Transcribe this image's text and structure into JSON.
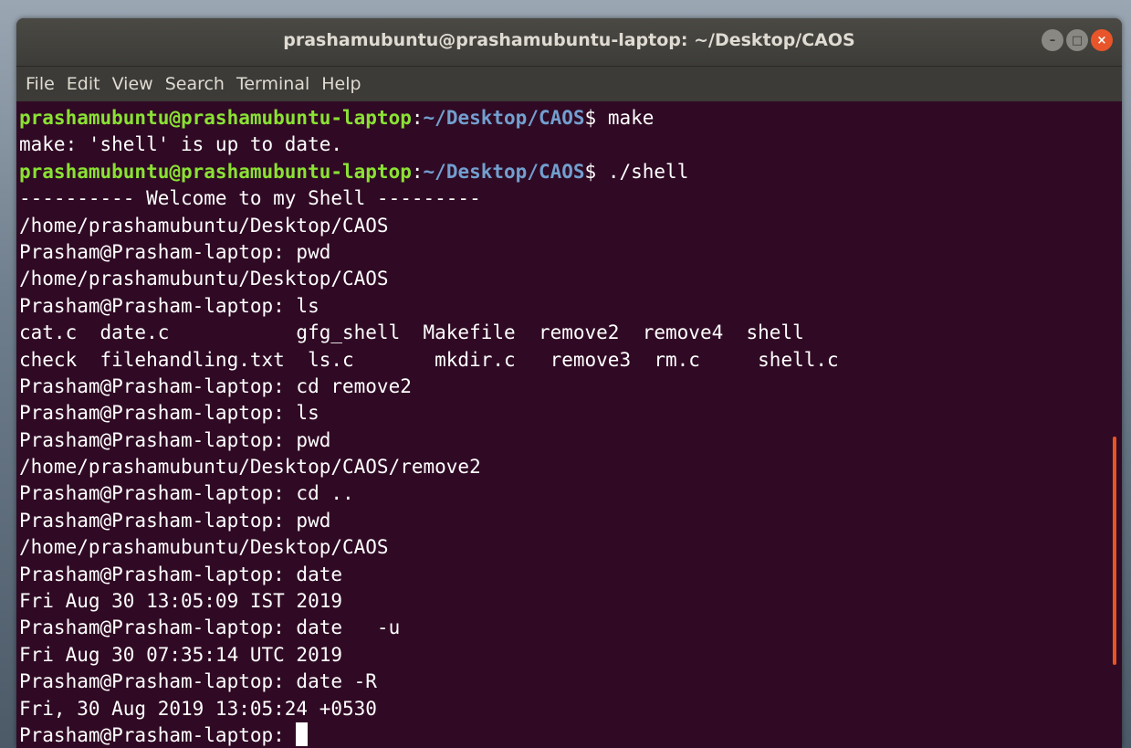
{
  "window": {
    "title": "prashamubuntu@prashamubuntu-laptop: ~/Desktop/CAOS",
    "controls": {
      "minimize": "–",
      "maximize": "□",
      "close": "×"
    }
  },
  "menu": {
    "items": [
      "File",
      "Edit",
      "View",
      "Search",
      "Terminal",
      "Help"
    ]
  },
  "prompt": {
    "user_host": "prashamubuntu@prashamubuntu-laptop",
    "colon": ":",
    "path": "~/Desktop/CAOS",
    "dollar": "$ "
  },
  "terminal": {
    "lines": [
      {
        "kind": "prompt",
        "cmd": "make"
      },
      {
        "kind": "text",
        "text": "make: 'shell' is up to date."
      },
      {
        "kind": "prompt",
        "cmd": "./shell"
      },
      {
        "kind": "text",
        "text": "---------- Welcome to my Shell ---------"
      },
      {
        "kind": "text",
        "text": "/home/prashamubuntu/Desktop/CAOS"
      },
      {
        "kind": "text",
        "text": "Prasham@Prasham-laptop: pwd"
      },
      {
        "kind": "text",
        "text": "/home/prashamubuntu/Desktop/CAOS"
      },
      {
        "kind": "text",
        "text": "Prasham@Prasham-laptop: ls"
      },
      {
        "kind": "text",
        "text": "cat.c  date.c           gfg_shell  Makefile  remove2  remove4  shell"
      },
      {
        "kind": "text",
        "text": "check  filehandling.txt  ls.c       mkdir.c   remove3  rm.c     shell.c"
      },
      {
        "kind": "text",
        "text": "Prasham@Prasham-laptop: cd remove2"
      },
      {
        "kind": "text",
        "text": "Prasham@Prasham-laptop: ls"
      },
      {
        "kind": "text",
        "text": "Prasham@Prasham-laptop: pwd"
      },
      {
        "kind": "text",
        "text": "/home/prashamubuntu/Desktop/CAOS/remove2"
      },
      {
        "kind": "text",
        "text": "Prasham@Prasham-laptop: cd .."
      },
      {
        "kind": "text",
        "text": "Prasham@Prasham-laptop: pwd"
      },
      {
        "kind": "text",
        "text": "/home/prashamubuntu/Desktop/CAOS"
      },
      {
        "kind": "text",
        "text": "Prasham@Prasham-laptop: date"
      },
      {
        "kind": "text",
        "text": "Fri Aug 30 13:05:09 IST 2019"
      },
      {
        "kind": "text",
        "text": "Prasham@Prasham-laptop: date   -u"
      },
      {
        "kind": "text",
        "text": "Fri Aug 30 07:35:14 UTC 2019"
      },
      {
        "kind": "text",
        "text": "Prasham@Prasham-laptop: date -R"
      },
      {
        "kind": "text",
        "text": "Fri, 30 Aug 2019 13:05:24 +0530"
      },
      {
        "kind": "cursor",
        "text": "Prasham@Prasham-laptop: "
      }
    ]
  },
  "colors": {
    "terminal_bg": "#300a24",
    "prompt_user": "#8ae234",
    "prompt_path": "#729fcf",
    "scrollbar": "#e95420",
    "close_button": "#e8552a"
  }
}
